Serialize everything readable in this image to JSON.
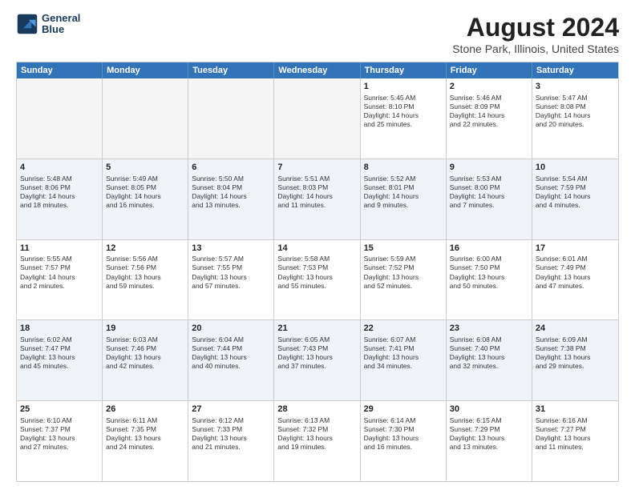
{
  "logo": {
    "line1": "General",
    "line2": "Blue"
  },
  "title": "August 2024",
  "subtitle": "Stone Park, Illinois, United States",
  "header_days": [
    "Sunday",
    "Monday",
    "Tuesday",
    "Wednesday",
    "Thursday",
    "Friday",
    "Saturday"
  ],
  "rows": [
    [
      {
        "day": "",
        "text": "",
        "empty": true
      },
      {
        "day": "",
        "text": "",
        "empty": true
      },
      {
        "day": "",
        "text": "",
        "empty": true
      },
      {
        "day": "",
        "text": "",
        "empty": true
      },
      {
        "day": "1",
        "text": "Sunrise: 5:45 AM\nSunset: 8:10 PM\nDaylight: 14 hours\nand 25 minutes."
      },
      {
        "day": "2",
        "text": "Sunrise: 5:46 AM\nSunset: 8:09 PM\nDaylight: 14 hours\nand 22 minutes."
      },
      {
        "day": "3",
        "text": "Sunrise: 5:47 AM\nSunset: 8:08 PM\nDaylight: 14 hours\nand 20 minutes."
      }
    ],
    [
      {
        "day": "4",
        "text": "Sunrise: 5:48 AM\nSunset: 8:06 PM\nDaylight: 14 hours\nand 18 minutes."
      },
      {
        "day": "5",
        "text": "Sunrise: 5:49 AM\nSunset: 8:05 PM\nDaylight: 14 hours\nand 16 minutes."
      },
      {
        "day": "6",
        "text": "Sunrise: 5:50 AM\nSunset: 8:04 PM\nDaylight: 14 hours\nand 13 minutes."
      },
      {
        "day": "7",
        "text": "Sunrise: 5:51 AM\nSunset: 8:03 PM\nDaylight: 14 hours\nand 11 minutes."
      },
      {
        "day": "8",
        "text": "Sunrise: 5:52 AM\nSunset: 8:01 PM\nDaylight: 14 hours\nand 9 minutes."
      },
      {
        "day": "9",
        "text": "Sunrise: 5:53 AM\nSunset: 8:00 PM\nDaylight: 14 hours\nand 7 minutes."
      },
      {
        "day": "10",
        "text": "Sunrise: 5:54 AM\nSunset: 7:59 PM\nDaylight: 14 hours\nand 4 minutes."
      }
    ],
    [
      {
        "day": "11",
        "text": "Sunrise: 5:55 AM\nSunset: 7:57 PM\nDaylight: 14 hours\nand 2 minutes."
      },
      {
        "day": "12",
        "text": "Sunrise: 5:56 AM\nSunset: 7:56 PM\nDaylight: 13 hours\nand 59 minutes."
      },
      {
        "day": "13",
        "text": "Sunrise: 5:57 AM\nSunset: 7:55 PM\nDaylight: 13 hours\nand 57 minutes."
      },
      {
        "day": "14",
        "text": "Sunrise: 5:58 AM\nSunset: 7:53 PM\nDaylight: 13 hours\nand 55 minutes."
      },
      {
        "day": "15",
        "text": "Sunrise: 5:59 AM\nSunset: 7:52 PM\nDaylight: 13 hours\nand 52 minutes."
      },
      {
        "day": "16",
        "text": "Sunrise: 6:00 AM\nSunset: 7:50 PM\nDaylight: 13 hours\nand 50 minutes."
      },
      {
        "day": "17",
        "text": "Sunrise: 6:01 AM\nSunset: 7:49 PM\nDaylight: 13 hours\nand 47 minutes."
      }
    ],
    [
      {
        "day": "18",
        "text": "Sunrise: 6:02 AM\nSunset: 7:47 PM\nDaylight: 13 hours\nand 45 minutes."
      },
      {
        "day": "19",
        "text": "Sunrise: 6:03 AM\nSunset: 7:46 PM\nDaylight: 13 hours\nand 42 minutes."
      },
      {
        "day": "20",
        "text": "Sunrise: 6:04 AM\nSunset: 7:44 PM\nDaylight: 13 hours\nand 40 minutes."
      },
      {
        "day": "21",
        "text": "Sunrise: 6:05 AM\nSunset: 7:43 PM\nDaylight: 13 hours\nand 37 minutes."
      },
      {
        "day": "22",
        "text": "Sunrise: 6:07 AM\nSunset: 7:41 PM\nDaylight: 13 hours\nand 34 minutes."
      },
      {
        "day": "23",
        "text": "Sunrise: 6:08 AM\nSunset: 7:40 PM\nDaylight: 13 hours\nand 32 minutes."
      },
      {
        "day": "24",
        "text": "Sunrise: 6:09 AM\nSunset: 7:38 PM\nDaylight: 13 hours\nand 29 minutes."
      }
    ],
    [
      {
        "day": "25",
        "text": "Sunrise: 6:10 AM\nSunset: 7:37 PM\nDaylight: 13 hours\nand 27 minutes."
      },
      {
        "day": "26",
        "text": "Sunrise: 6:11 AM\nSunset: 7:35 PM\nDaylight: 13 hours\nand 24 minutes."
      },
      {
        "day": "27",
        "text": "Sunrise: 6:12 AM\nSunset: 7:33 PM\nDaylight: 13 hours\nand 21 minutes."
      },
      {
        "day": "28",
        "text": "Sunrise: 6:13 AM\nSunset: 7:32 PM\nDaylight: 13 hours\nand 19 minutes."
      },
      {
        "day": "29",
        "text": "Sunrise: 6:14 AM\nSunset: 7:30 PM\nDaylight: 13 hours\nand 16 minutes."
      },
      {
        "day": "30",
        "text": "Sunrise: 6:15 AM\nSunset: 7:29 PM\nDaylight: 13 hours\nand 13 minutes."
      },
      {
        "day": "31",
        "text": "Sunrise: 6:16 AM\nSunset: 7:27 PM\nDaylight: 13 hours\nand 11 minutes."
      }
    ]
  ]
}
